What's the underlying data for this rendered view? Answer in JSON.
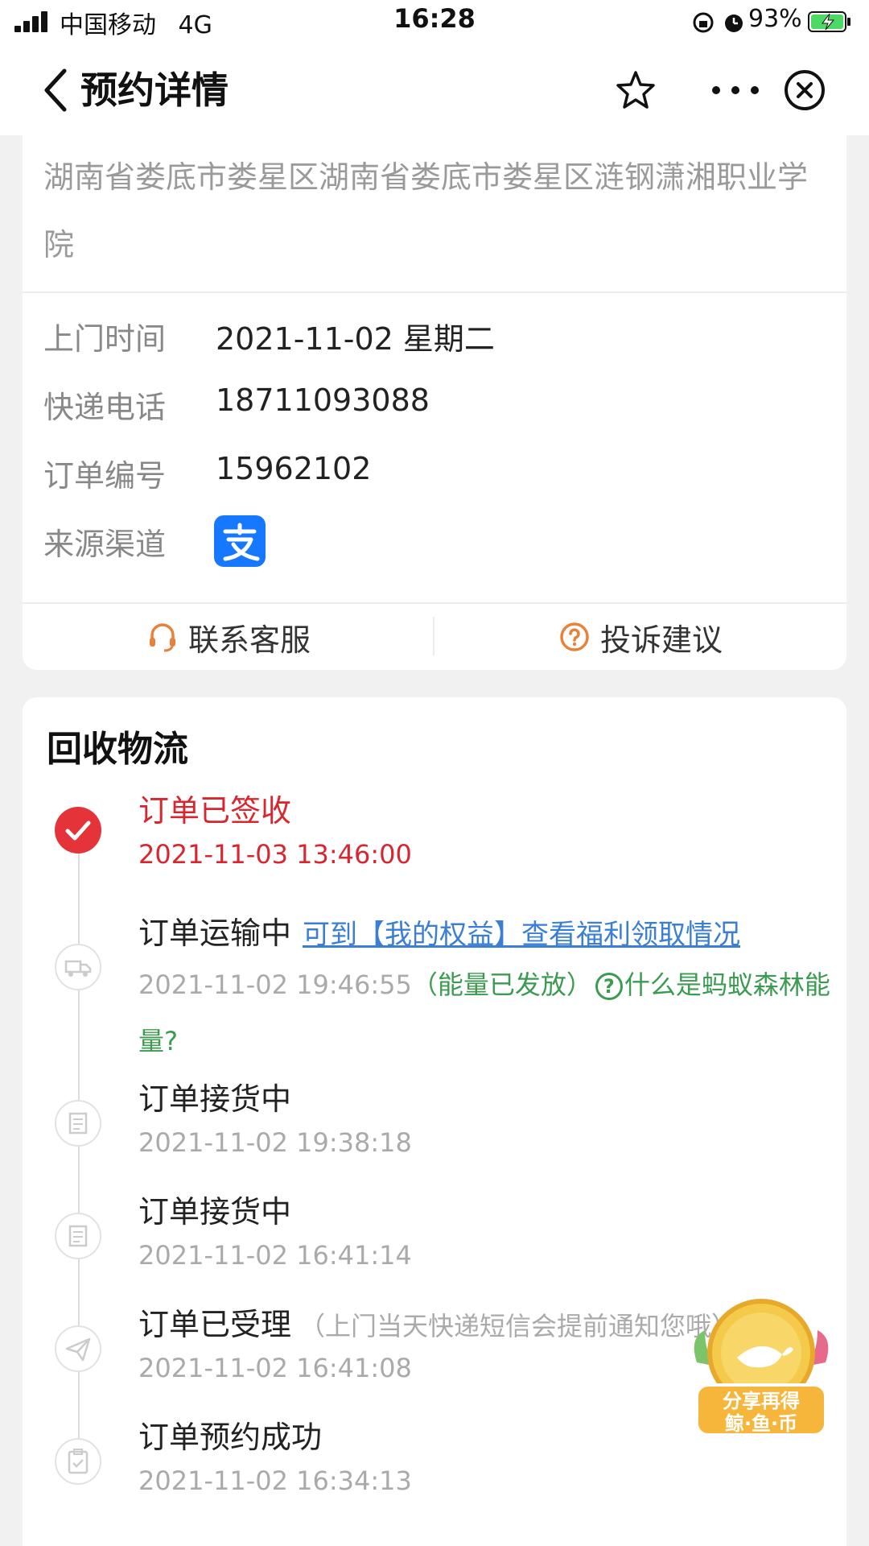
{
  "status_bar": {
    "carrier": "中国移动",
    "network": "4G",
    "time": "16:28",
    "battery": "93%"
  },
  "nav": {
    "title": "预约详情"
  },
  "address": "湖南省娄底市娄星区湖南省娄底市娄星区涟钢潇湘职业学院",
  "details": {
    "visit_time_label": "上门时间",
    "visit_time_value": "2021-11-02 星期二",
    "courier_phone_label": "快递电话",
    "courier_phone_value": "18711093088",
    "order_no_label": "订单编号",
    "order_no_value": "15962102",
    "source_label": "来源渠道",
    "source_icon": "alipay-icon"
  },
  "actions": {
    "contact_service": "联系客服",
    "complaint": "投诉建议"
  },
  "logistics": {
    "title": "回收物流",
    "steps": [
      {
        "title": "订单已签收",
        "time": "2021-11-03 13:46:00",
        "icon": "check-icon"
      },
      {
        "title": "订单运输中",
        "link": "可到【我的权益】查看福利领取情况",
        "time": "2021-11-02 19:46:55",
        "energy_note": "（能量已发放）",
        "energy_question": "什么是蚂蚁森林能量?",
        "icon": "truck-icon"
      },
      {
        "title": "订单接货中",
        "time": "2021-11-02 19:38:18",
        "icon": "package-icon"
      },
      {
        "title": "订单接货中",
        "time": "2021-11-02 16:41:14",
        "icon": "package-icon"
      },
      {
        "title": "订单已受理",
        "note": "（上门当天快递短信会提前通知您哦）",
        "time": "2021-11-02 16:41:08",
        "icon": "paper-plane-icon"
      },
      {
        "title": "订单预约成功",
        "time": "2021-11-02 16:34:13",
        "icon": "clipboard-icon"
      }
    ]
  },
  "badge": {
    "line1": "分享再得",
    "line2": "鲸·鱼·币"
  },
  "colors": {
    "accent_red": "#d8262f",
    "link_blue": "#3a7fd5",
    "energy_green": "#3b9b50",
    "alipay_blue": "#1677ff",
    "icon_orange": "#e8813a"
  }
}
